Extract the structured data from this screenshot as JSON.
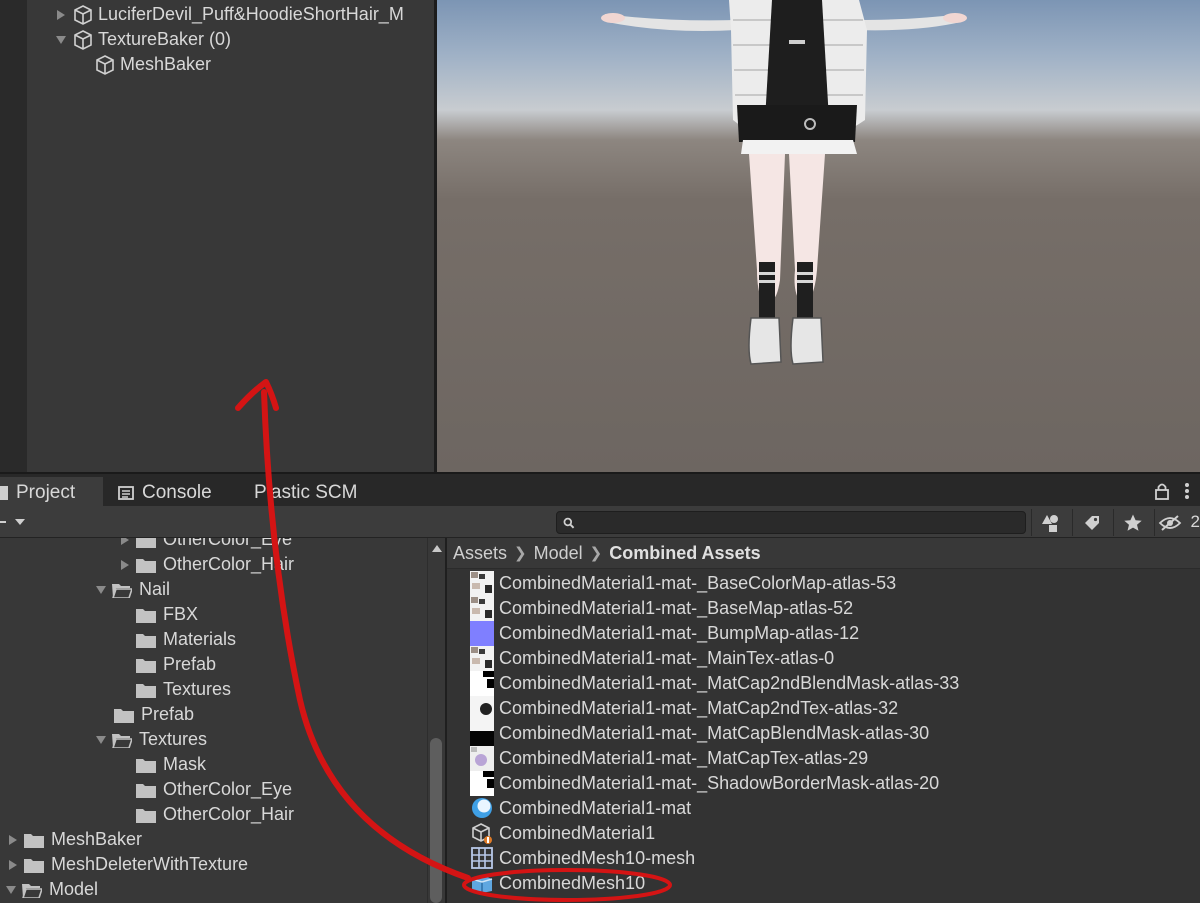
{
  "hierarchy": {
    "items": [
      {
        "label": "LuciferDevil_Puff&HoodieShortHair_M",
        "expanded": false
      },
      {
        "label": "TextureBaker (0)",
        "expanded": true
      },
      {
        "label": "MeshBaker"
      }
    ]
  },
  "scene": {
    "sky_color": "#9fb1c6",
    "ground_color": "#6f6762",
    "avatar": "3D avatar in T-pose wearing white puffer jacket, black hoodie, white skirt and sneakers"
  },
  "tabs": [
    {
      "label": "Project",
      "icon": "project-icon",
      "active": true
    },
    {
      "label": "Console",
      "icon": "console-icon",
      "active": false
    },
    {
      "label": "Plastic SCM",
      "icon": "plastic-scm-icon",
      "active": false
    }
  ],
  "toolbar": {
    "search_placeholder": "",
    "hidden_packages_count": "2"
  },
  "folder_tree": [
    {
      "label": "OtherColor_Eye",
      "expanded": false
    },
    {
      "label": "OtherColor_Hair",
      "expanded": false
    },
    {
      "label": "Nail",
      "expanded": true
    },
    {
      "label": "FBX"
    },
    {
      "label": "Materials"
    },
    {
      "label": "Prefab"
    },
    {
      "label": "Textures"
    },
    {
      "label": "Prefab"
    },
    {
      "label": "Textures",
      "expanded": true
    },
    {
      "label": "Mask"
    },
    {
      "label": "OtherColor_Eye"
    },
    {
      "label": "OtherColor_Hair"
    },
    {
      "label": "MeshBaker",
      "expanded": false
    },
    {
      "label": "MeshDeleterWithTexture",
      "expanded": false
    },
    {
      "label": "Model",
      "expanded": true
    }
  ],
  "breadcrumb": {
    "items": [
      "Assets",
      "Model",
      "Combined Assets"
    ]
  },
  "assets": [
    {
      "label": "CombinedMaterial1-mat-_BaseColorMap-atlas-53",
      "type": "texture"
    },
    {
      "label": "CombinedMaterial1-mat-_BaseMap-atlas-52",
      "type": "texture"
    },
    {
      "label": "CombinedMaterial1-mat-_BumpMap-atlas-12",
      "type": "normal-map"
    },
    {
      "label": "CombinedMaterial1-mat-_MainTex-atlas-0",
      "type": "texture"
    },
    {
      "label": "CombinedMaterial1-mat-_MatCap2ndBlendMask-atlas-33",
      "type": "mask"
    },
    {
      "label": "CombinedMaterial1-mat-_MatCap2ndTex-atlas-32",
      "type": "matcap"
    },
    {
      "label": "CombinedMaterial1-mat-_MatCapBlendMask-atlas-30",
      "type": "mask-dark"
    },
    {
      "label": "CombinedMaterial1-mat-_MatCapTex-atlas-29",
      "type": "matcap-color"
    },
    {
      "label": "CombinedMaterial1-mat-_ShadowBorderMask-atlas-20",
      "type": "mask"
    },
    {
      "label": "CombinedMaterial1-mat",
      "type": "material"
    },
    {
      "label": "CombinedMaterial1",
      "type": "scriptable-object"
    },
    {
      "label": "CombinedMesh10-mesh",
      "type": "mesh"
    },
    {
      "label": "CombinedMesh10",
      "type": "prefab"
    }
  ],
  "annotation": {
    "color": "#d41414"
  }
}
